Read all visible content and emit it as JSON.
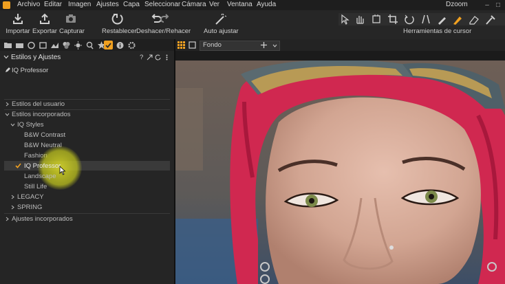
{
  "menubar": {
    "items": [
      "Archivo",
      "Editar",
      "Imagen",
      "Ajustes",
      "Capa",
      "Seleccionar",
      "Cámara",
      "Ver",
      "Ventana",
      "Ayuda"
    ],
    "title": "Dzoom"
  },
  "toolbar": {
    "import": "Importar",
    "export": "Exportar",
    "capture": "Capturar",
    "reset": "Restablecer",
    "undo_redo": "Deshacer/Rehacer",
    "auto_adjust": "Auto ajustar",
    "cursor_tools": "Herramientas de cursor"
  },
  "panel": {
    "title": "Estilos y Ajustes",
    "help": "?",
    "current_style": "IQ Professor",
    "user_styles": "Estilos del usuario",
    "builtin_styles": "Estilos incorporados",
    "iq_styles": "IQ Styles",
    "styles": [
      "B&W Contrast",
      "B&W Neutral",
      "Fashion",
      "IQ Professor",
      "Landscape",
      "Still Life"
    ],
    "legacy": "LEGACY",
    "spring": "SPRING",
    "builtin_adjustments": "Ajustes incorporados"
  },
  "viewer": {
    "background_select": "Fondo"
  },
  "colors": {
    "accent": "#f0a020",
    "hair": "#d02850"
  }
}
